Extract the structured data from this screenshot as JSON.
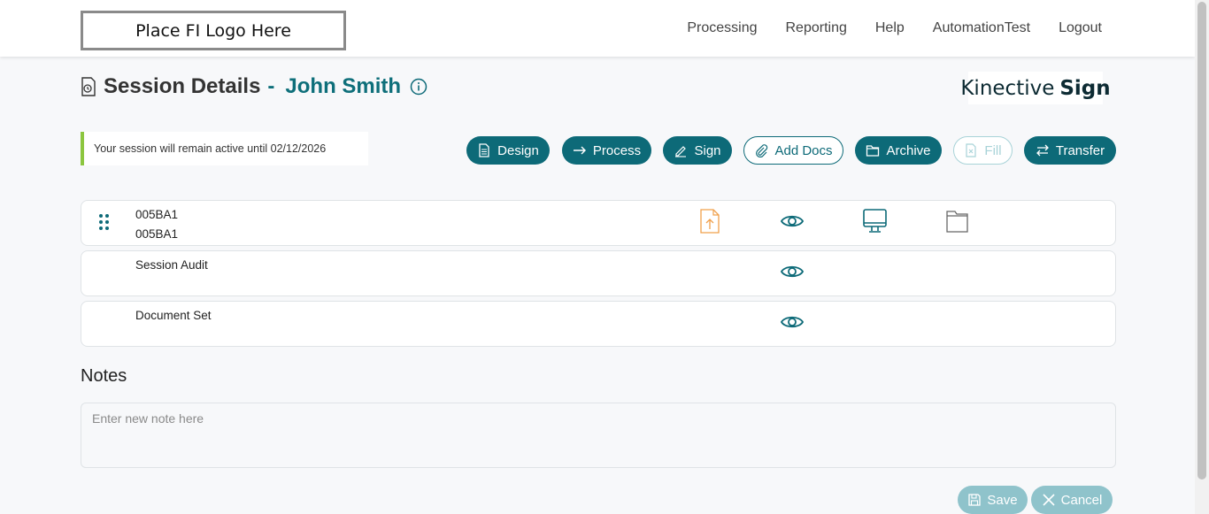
{
  "header": {
    "logo_text": "Place FI Logo Here",
    "nav": [
      "Processing",
      "Reporting",
      "Help",
      "AutomationTest",
      "Logout"
    ]
  },
  "page": {
    "title": "Session Details",
    "dash": "-",
    "customer_name": "John Smith",
    "brand_light": "Kinective",
    "brand_bold": "Sign"
  },
  "notice": {
    "text": "Your session will remain active until 02/12/2026"
  },
  "actions": {
    "design": "Design",
    "process": "Process",
    "sign": "Sign",
    "add_docs": "Add Docs",
    "archive": "Archive",
    "fill": "Fill",
    "transfer": "Transfer"
  },
  "documents": [
    {
      "line1": "005BA1",
      "line2": "005BA1"
    },
    {
      "line1": "Session Audit"
    },
    {
      "line1": "Document Set"
    }
  ],
  "notes": {
    "label": "Notes",
    "placeholder": "Enter new note here"
  },
  "footer": {
    "save": "Save",
    "cancel": "Cancel"
  },
  "colors": {
    "accent": "#0d6a78",
    "notice_bar": "#8cc63f",
    "upload_icon": "#f0a04b"
  }
}
